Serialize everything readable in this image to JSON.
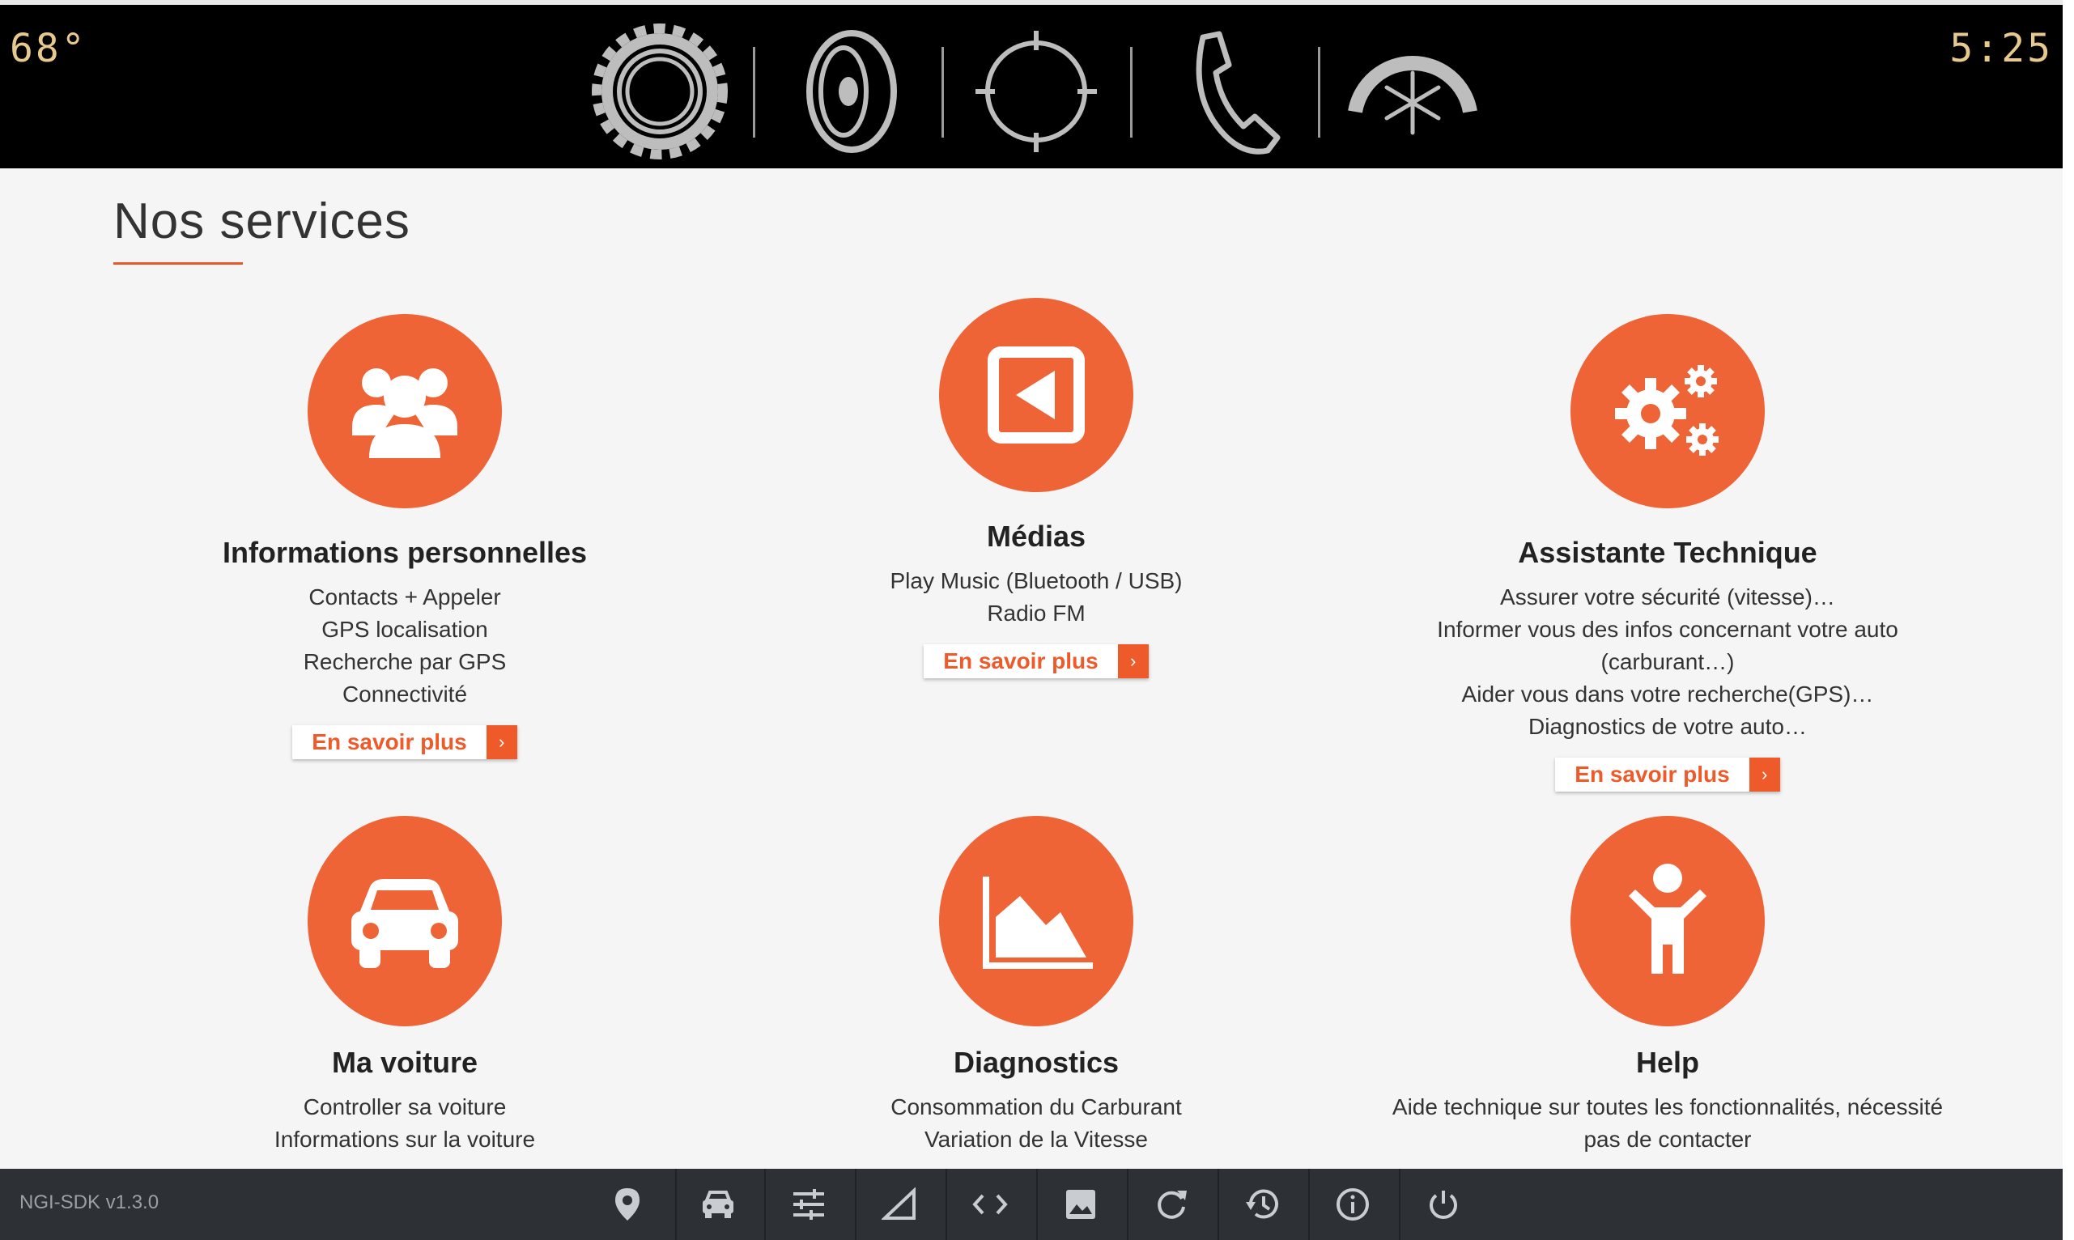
{
  "topbar": {
    "temperature": "68°",
    "time": "5:25",
    "icons": [
      "settings-icon",
      "speaker-icon",
      "navigation-icon",
      "phone-icon",
      "climate-icon"
    ]
  },
  "page": {
    "title": "Nos services"
  },
  "services": [
    {
      "title": "Informations personnelles",
      "icon": "users-icon",
      "lines": [
        "Contacts + Appeler",
        "GPS localisation",
        "Recherche par GPS",
        "Connectivité"
      ],
      "button": "En savoir plus"
    },
    {
      "title": "Médias",
      "icon": "media-icon",
      "lines": [
        "Play Music (Bluetooth / USB)",
        "Radio FM"
      ],
      "button": "En savoir plus"
    },
    {
      "title": "Assistante Technique",
      "icon": "gears-icon",
      "lines": [
        "Assurer votre sécurité (vitesse)…",
        "Informer vous des infos concernant votre auto",
        "(carburant…)",
        "Aider vous dans votre recherche(GPS)…",
        "Diagnostics de votre auto…"
      ],
      "button": "En savoir plus"
    },
    {
      "title": "Ma voiture",
      "icon": "car-icon",
      "lines": [
        "Controller sa voiture",
        "Informations sur la voiture"
      ]
    },
    {
      "title": "Diagnostics",
      "icon": "area-chart-icon",
      "lines": [
        "Consommation du Carburant",
        "Variation de la Vitesse"
      ]
    },
    {
      "title": "Help",
      "icon": "person-icon",
      "lines": [
        "Aide technique sur toutes les fonctionnalités, nécessité",
        "pas de contacter"
      ]
    }
  ],
  "bottombar": {
    "version": "NGI-SDK v1.3.0",
    "icons": [
      "location-pin-icon",
      "car-icon",
      "tune-icon",
      "signal-icon",
      "code-icon",
      "image-icon",
      "refresh-icon",
      "history-icon",
      "info-icon",
      "power-icon"
    ]
  },
  "colors": {
    "accent": "#ee6437",
    "topbar_bg": "#000000",
    "bottombar_bg": "#2d3035",
    "clock_text": "#e7c98d"
  }
}
